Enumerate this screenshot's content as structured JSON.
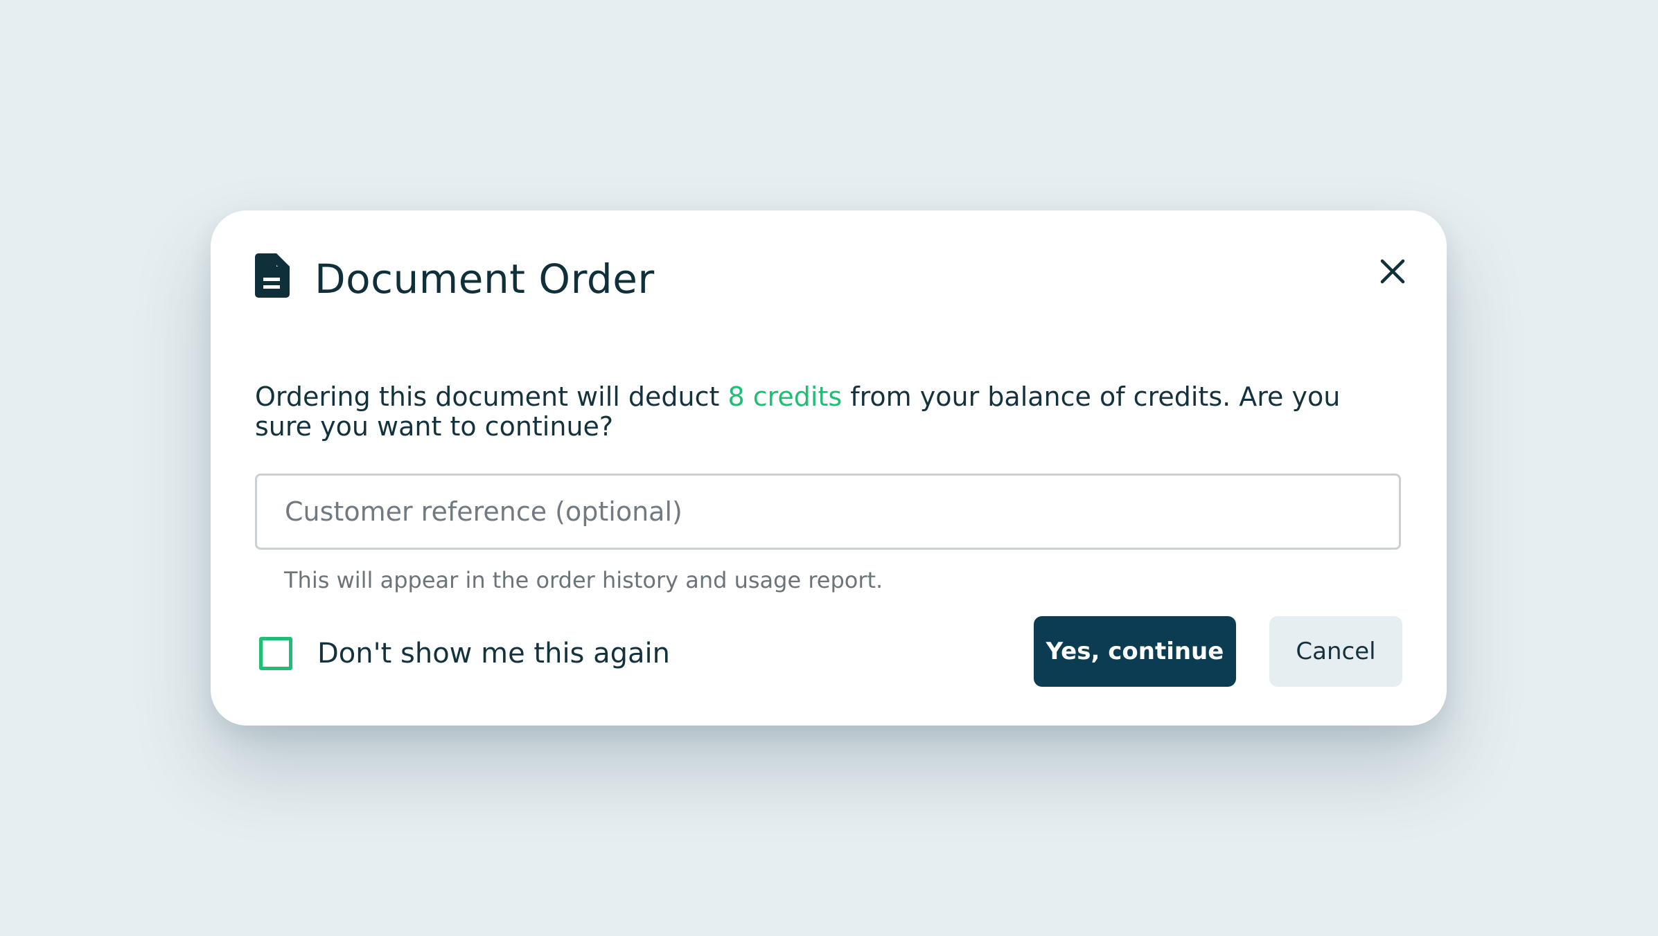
{
  "dialog": {
    "title": "Document Order",
    "title_icon": "document-icon",
    "close_icon": "close-icon",
    "message": {
      "before": "Ordering this document will deduct ",
      "highlight": "8 credits",
      "after": " from your balance of credits. Are you sure you want to continue?"
    },
    "reference_input": {
      "value": "",
      "placeholder": "Customer reference (optional)"
    },
    "hint": "This will appear in the order history and usage report.",
    "dont_show_again": {
      "label": "Don't show me this again",
      "checked": false
    },
    "confirm_label": "Yes, continue",
    "cancel_label": "Cancel"
  },
  "colors": {
    "background": "#e6eef1",
    "primary": "#0b3c52",
    "accent": "#1fbf73",
    "text": "#14323d",
    "secondary_button": "#e7eef1"
  }
}
